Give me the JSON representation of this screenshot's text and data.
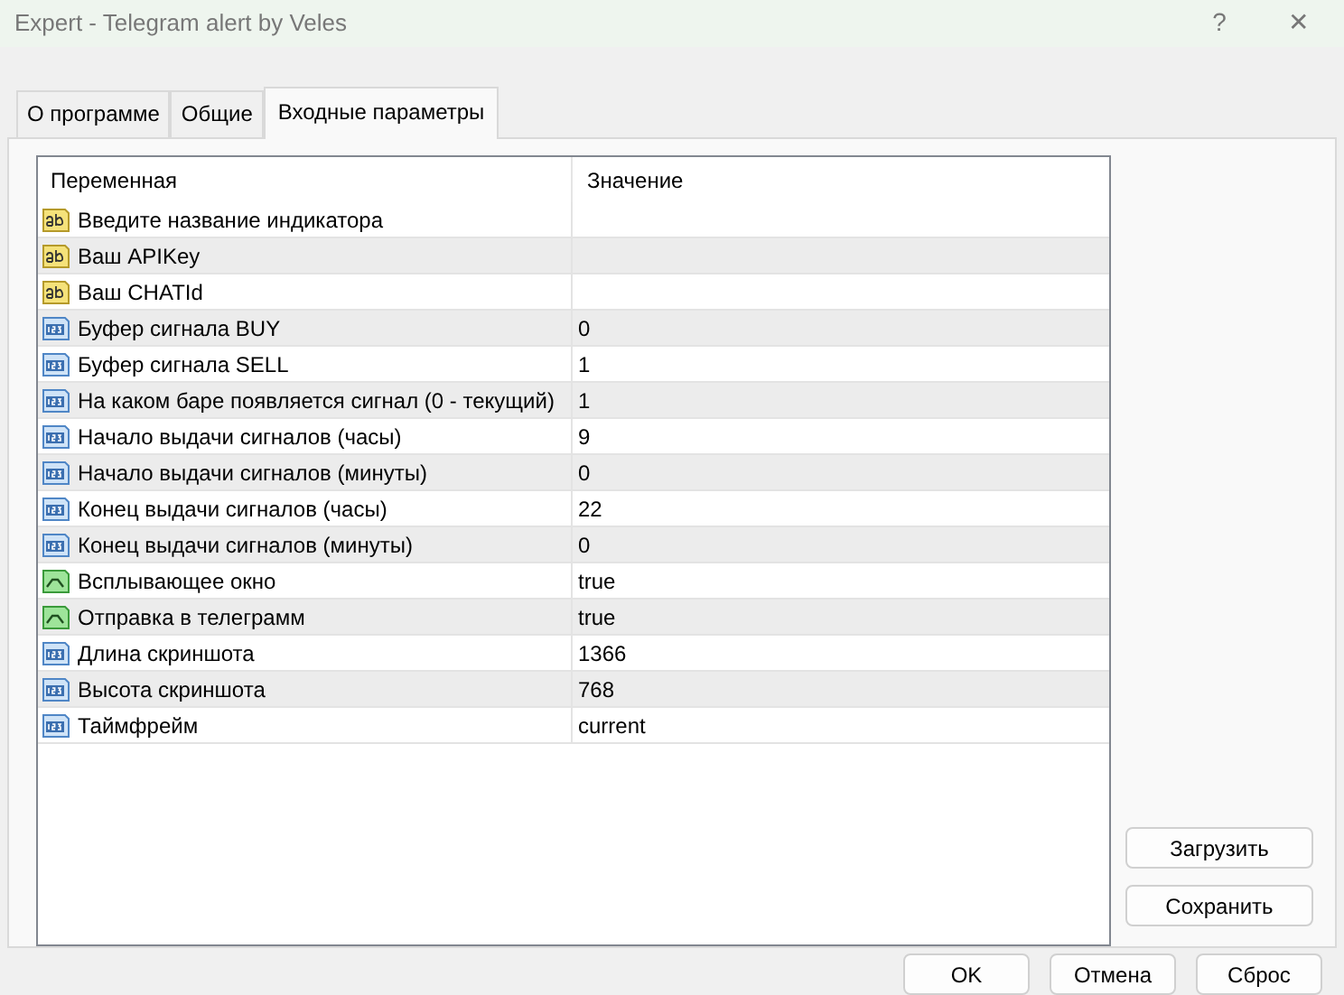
{
  "window": {
    "title": "Expert - Telegram alert by Veles",
    "help": "?",
    "close": "✕"
  },
  "tabs": [
    {
      "label": "О программе",
      "selected": false
    },
    {
      "label": "Общие",
      "selected": false
    },
    {
      "label": "Входные параметры",
      "selected": true
    }
  ],
  "table": {
    "columns": [
      "Переменная",
      "Значение"
    ],
    "rows": [
      {
        "kind": "string",
        "name": "Введите название индикатора",
        "value": ""
      },
      {
        "kind": "string",
        "name": "Ваш APIKey",
        "value": ""
      },
      {
        "kind": "string",
        "name": "Ваш CHATId",
        "value": ""
      },
      {
        "kind": "int",
        "name": "Буфер сигнала BUY",
        "value": "0"
      },
      {
        "kind": "int",
        "name": "Буфер сигнала SELL",
        "value": "1"
      },
      {
        "kind": "int",
        "name": "На каком баре появляется сигнал (0 - текущий)",
        "value": "1"
      },
      {
        "kind": "int",
        "name": "Начало выдачи сигналов (часы)",
        "value": "9"
      },
      {
        "kind": "int",
        "name": "Начало выдачи сигналов (минуты)",
        "value": "0"
      },
      {
        "kind": "int",
        "name": "Конец выдачи сигналов (часы)",
        "value": "22"
      },
      {
        "kind": "int",
        "name": "Конец выдачи сигналов (минуты)",
        "value": "0"
      },
      {
        "kind": "bool",
        "name": "Всплывающее окно",
        "value": "true"
      },
      {
        "kind": "bool",
        "name": "Отправка в телеграмм",
        "value": "true"
      },
      {
        "kind": "int",
        "name": "Длина скриншота",
        "value": "1366"
      },
      {
        "kind": "int",
        "name": "Высота скриншота",
        "value": "768"
      },
      {
        "kind": "int",
        "name": "Таймфрейм",
        "value": "current"
      }
    ]
  },
  "side_buttons": [
    "Загрузить",
    "Сохранить"
  ],
  "buttons": [
    "OK",
    "Отмена",
    "Сброс"
  ]
}
